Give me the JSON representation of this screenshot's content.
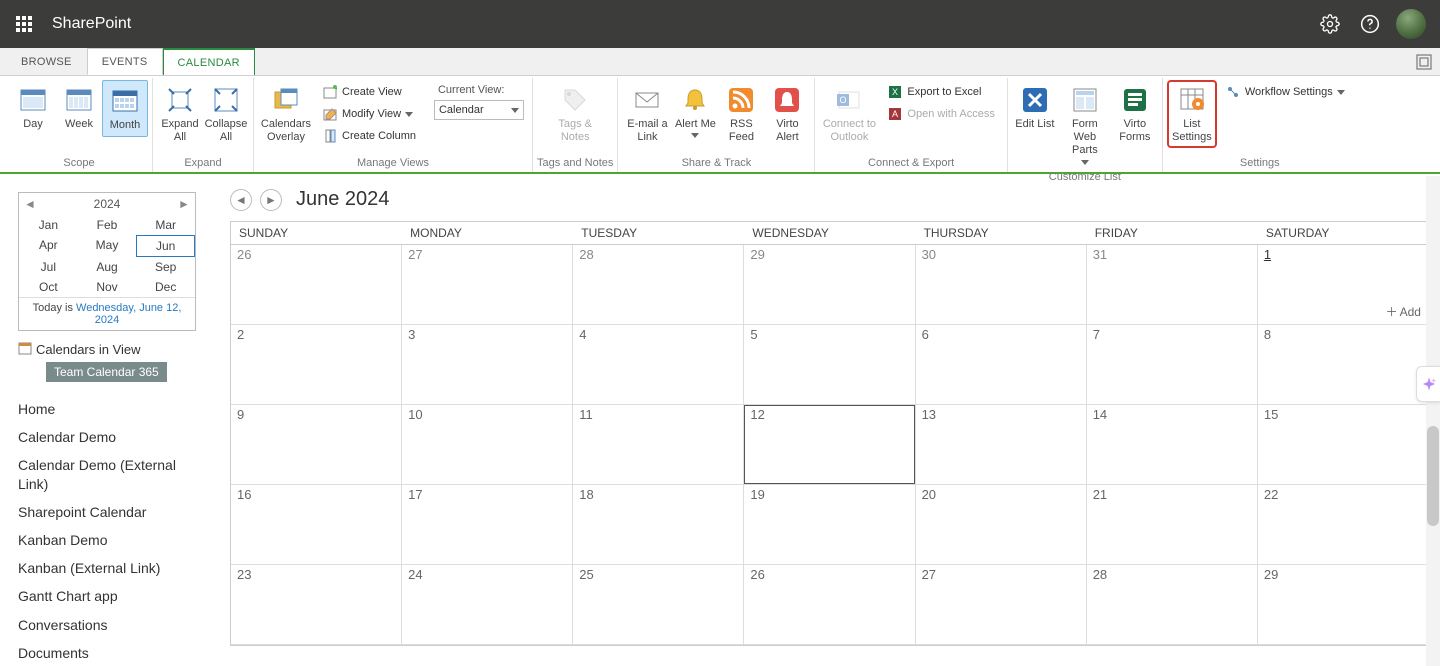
{
  "top": {
    "appName": "SharePoint"
  },
  "tabs": {
    "browse": "BROWSE",
    "events": "EVENTS",
    "calendar": "CALENDAR"
  },
  "ribbon": {
    "scope": {
      "label": "Scope",
      "day": "Day",
      "week": "Week",
      "month": "Month"
    },
    "expand": {
      "label": "Expand",
      "expandAll": "Expand All",
      "collapseAll": "Collapse All"
    },
    "manageViews": {
      "label": "Manage Views",
      "calendarsOverlay": "Calendars Overlay",
      "createView": "Create View",
      "modifyView": "Modify View",
      "createColumn": "Create Column",
      "currentViewLabel": "Current View:",
      "currentViewValue": "Calendar"
    },
    "tagsNotes": {
      "label": "Tags and Notes",
      "tags": "Tags & Notes"
    },
    "shareTrack": {
      "label": "Share & Track",
      "emailLink": "E-mail a Link",
      "alertMe": "Alert Me",
      "rssFeed": "RSS Feed",
      "virtoAlert": "Virto Alert"
    },
    "connectExport": {
      "label": "Connect & Export",
      "connectOutlook": "Connect to Outlook",
      "exportExcel": "Export to Excel",
      "openAccess": "Open with Access"
    },
    "customizeList": {
      "label": "Customize List",
      "editList": "Edit List",
      "formWebParts": "Form Web Parts",
      "virtoForms": "Virto Forms"
    },
    "settings": {
      "label": "Settings",
      "listSettings": "List Settings",
      "workflowSettings": "Workflow Settings"
    }
  },
  "miniCal": {
    "year": "2024",
    "months": [
      "Jan",
      "Feb",
      "Mar",
      "Apr",
      "May",
      "Jun",
      "Jul",
      "Aug",
      "Sep",
      "Oct",
      "Nov",
      "Dec"
    ],
    "currentIndex": 5,
    "todayPrefix": "Today is ",
    "todayDate": "Wednesday, June 12, 2024"
  },
  "calendarsInView": {
    "label": "Calendars in View",
    "items": [
      "Team Calendar 365"
    ]
  },
  "nav": [
    "Home",
    "Calendar Demo",
    "Calendar Demo (External Link)",
    "Sharepoint Calendar",
    "Kanban Demo",
    "Kanban (External Link)",
    "Gantt Chart app",
    "Conversations",
    "Documents"
  ],
  "calendar": {
    "title": "June 2024",
    "dayHeaders": [
      "SUNDAY",
      "MONDAY",
      "TUESDAY",
      "WEDNESDAY",
      "THURSDAY",
      "FRIDAY",
      "SATURDAY"
    ],
    "weeks": [
      [
        {
          "n": "26",
          "other": true
        },
        {
          "n": "27",
          "other": true
        },
        {
          "n": "28",
          "other": true
        },
        {
          "n": "29",
          "other": true
        },
        {
          "n": "30",
          "other": true
        },
        {
          "n": "31",
          "other": true
        },
        {
          "n": "1",
          "link": true
        }
      ],
      [
        {
          "n": "2"
        },
        {
          "n": "3"
        },
        {
          "n": "4"
        },
        {
          "n": "5"
        },
        {
          "n": "6"
        },
        {
          "n": "7"
        },
        {
          "n": "8"
        }
      ],
      [
        {
          "n": "9"
        },
        {
          "n": "10"
        },
        {
          "n": "11"
        },
        {
          "n": "12",
          "today": true
        },
        {
          "n": "13"
        },
        {
          "n": "14"
        },
        {
          "n": "15"
        }
      ],
      [
        {
          "n": "16"
        },
        {
          "n": "17"
        },
        {
          "n": "18"
        },
        {
          "n": "19"
        },
        {
          "n": "20"
        },
        {
          "n": "21"
        },
        {
          "n": "22"
        }
      ],
      [
        {
          "n": "23"
        },
        {
          "n": "24"
        },
        {
          "n": "25"
        },
        {
          "n": "26"
        },
        {
          "n": "27"
        },
        {
          "n": "28"
        },
        {
          "n": "29"
        }
      ]
    ],
    "addLabel": "Add"
  }
}
